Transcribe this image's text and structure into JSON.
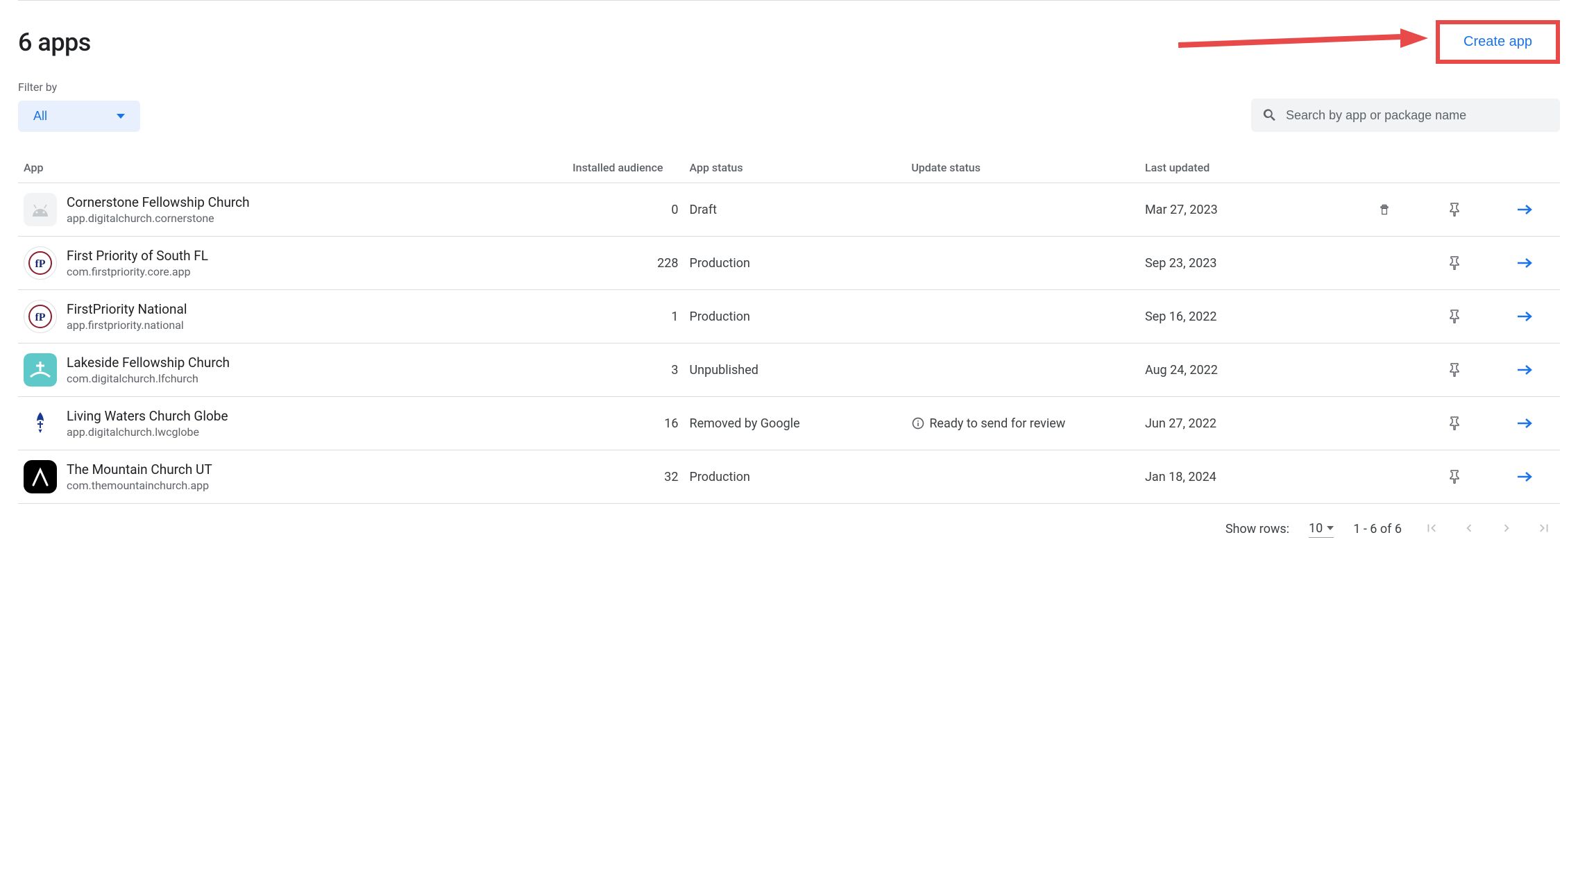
{
  "header": {
    "title": "6 apps",
    "create_button": "Create app"
  },
  "filter": {
    "label": "Filter by",
    "selected": "All"
  },
  "search": {
    "placeholder": "Search by app or package name"
  },
  "columns": {
    "app": "App",
    "installed": "Installed audience",
    "status": "App status",
    "update": "Update status",
    "updated": "Last updated"
  },
  "apps": [
    {
      "name": "Cornerstone Fellowship Church",
      "package": "app.digitalchurch.cornerstone",
      "installed": "0",
      "status": "Draft",
      "update_status": "",
      "last_updated": "Mar 27, 2023",
      "has_delete": true,
      "icon_style": "android"
    },
    {
      "name": "First Priority of South FL",
      "package": "com.firstpriority.core.app",
      "installed": "228",
      "status": "Production",
      "update_status": "",
      "last_updated": "Sep 23, 2023",
      "has_delete": false,
      "icon_style": "fp"
    },
    {
      "name": "FirstPriority National",
      "package": "app.firstpriority.national",
      "installed": "1",
      "status": "Production",
      "update_status": "",
      "last_updated": "Sep 16, 2022",
      "has_delete": false,
      "icon_style": "fp"
    },
    {
      "name": "Lakeside Fellowship Church",
      "package": "com.digitalchurch.lfchurch",
      "installed": "3",
      "status": "Unpublished",
      "update_status": "",
      "last_updated": "Aug 24, 2022",
      "has_delete": false,
      "icon_style": "lakeside"
    },
    {
      "name": "Living Waters Church Globe",
      "package": "app.digitalchurch.lwcglobe",
      "installed": "16",
      "status": "Removed by Google",
      "update_status": "Ready to send for review",
      "last_updated": "Jun 27, 2022",
      "has_delete": false,
      "icon_style": "living"
    },
    {
      "name": "The Mountain Church UT",
      "package": "com.themountainchurch.app",
      "installed": "32",
      "status": "Production",
      "update_status": "",
      "last_updated": "Jan 18, 2024",
      "has_delete": false,
      "icon_style": "mountain"
    }
  ],
  "pagination": {
    "show_rows_label": "Show rows:",
    "rows_value": "10",
    "range": "1 - 6 of 6"
  }
}
